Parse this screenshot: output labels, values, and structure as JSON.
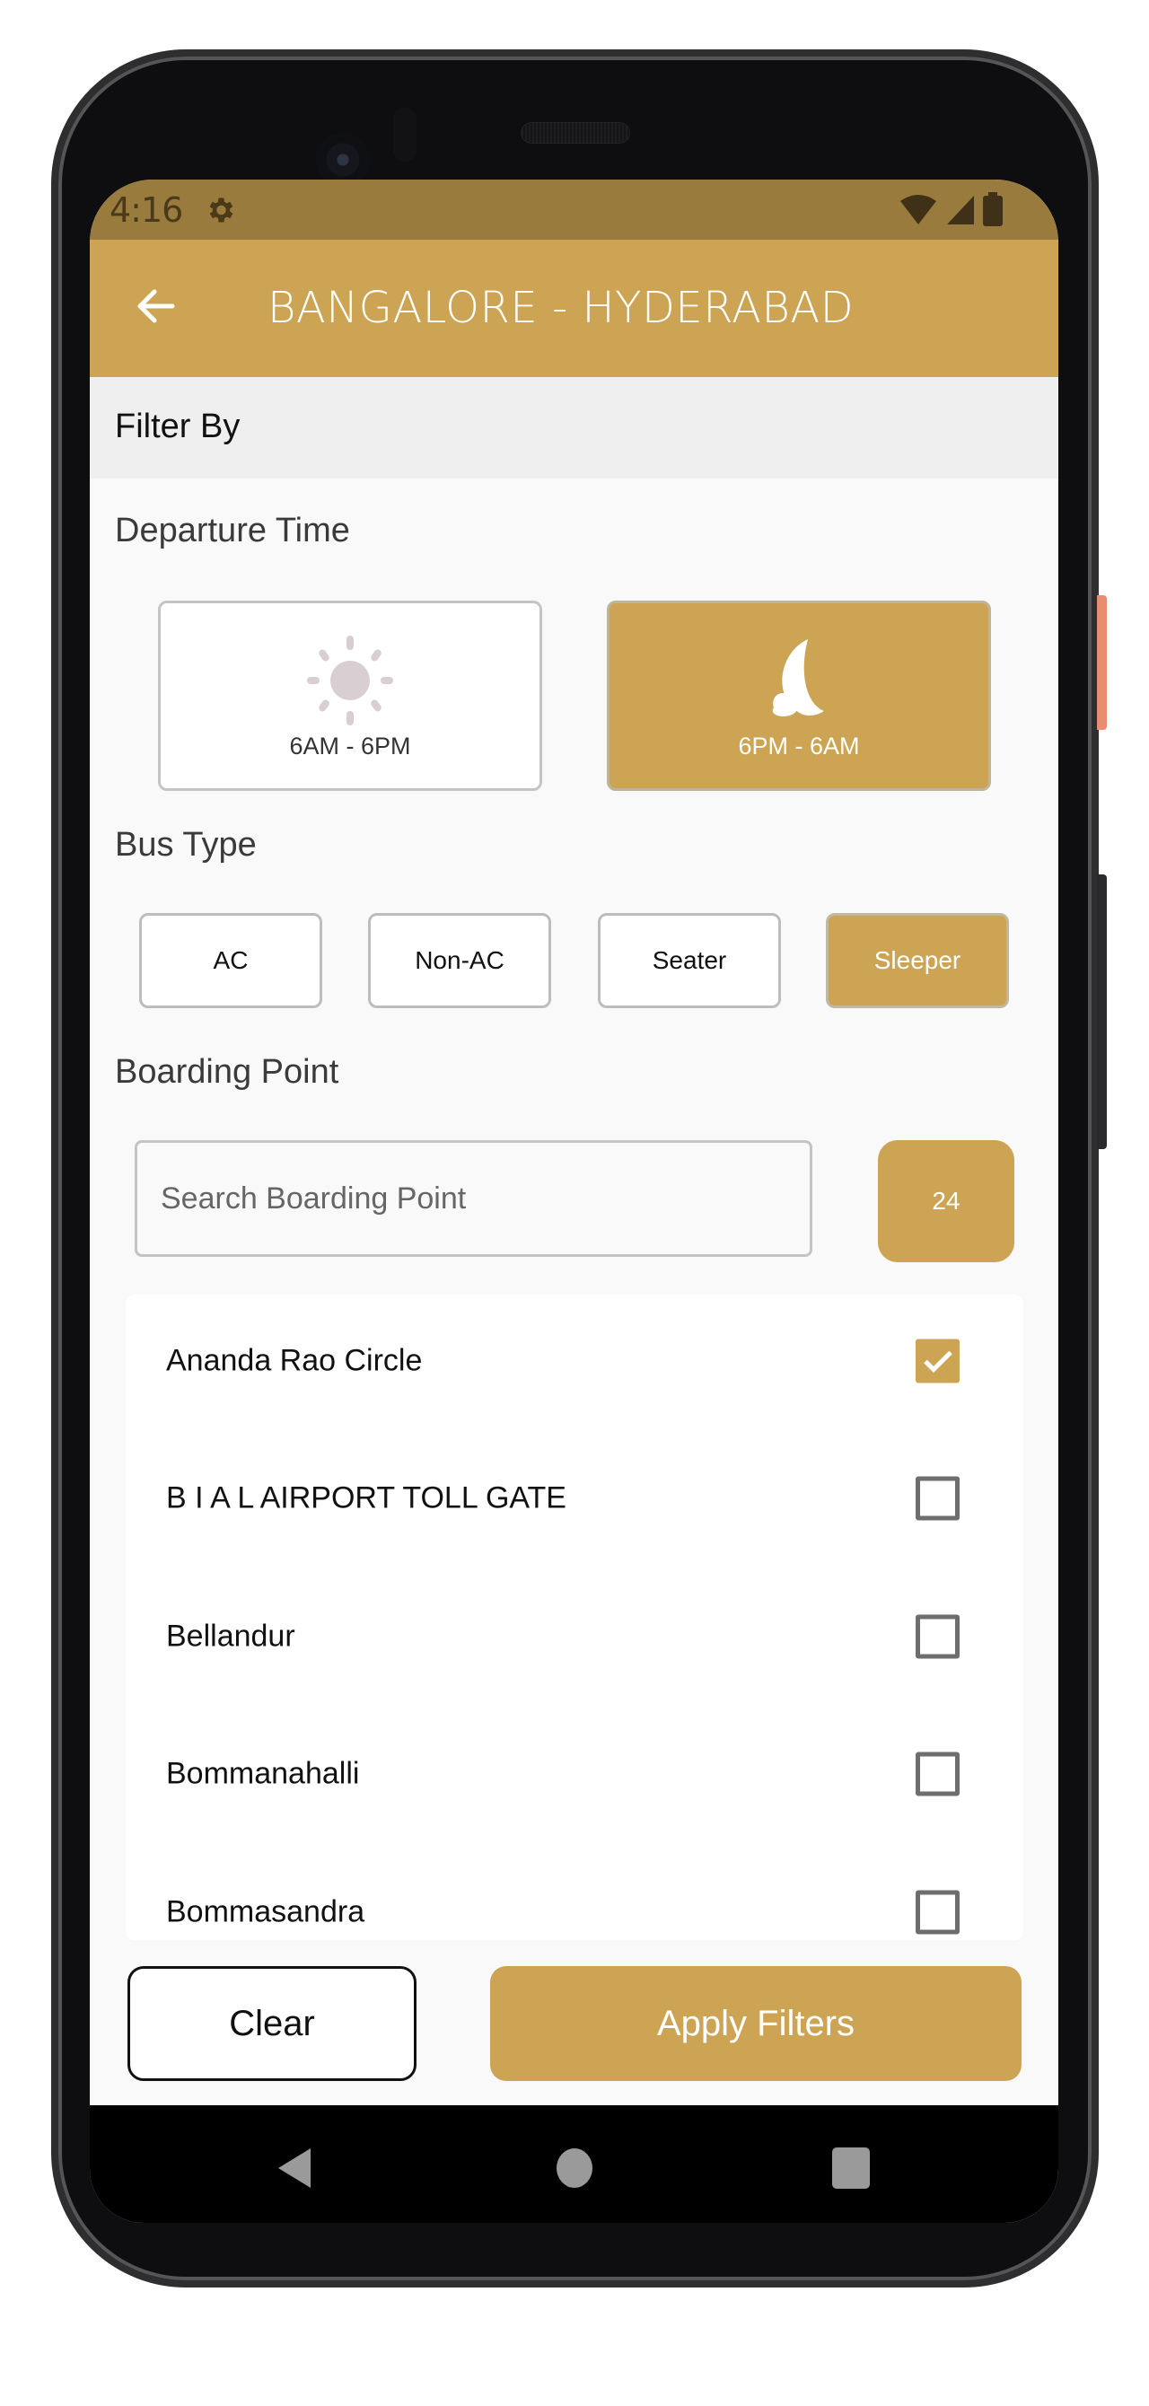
{
  "status_bar": {
    "time": "4:16",
    "icons": [
      "settings-gear-icon",
      "wifi-icon",
      "cellular-signal-icon",
      "battery-icon"
    ]
  },
  "header": {
    "back_icon": "arrow-left-icon",
    "title": "BANGALORE - HYDERABAD"
  },
  "filter_by": {
    "label": "Filter By"
  },
  "departure_time": {
    "label": "Departure Time",
    "options": [
      {
        "label": "6AM - 6PM",
        "icon": "sun-icon",
        "selected": false
      },
      {
        "label": "6PM - 6AM",
        "icon": "moon-cloud-icon",
        "selected": true
      }
    ]
  },
  "bus_type": {
    "label": "Bus Type",
    "options": [
      {
        "label": "AC",
        "selected": false
      },
      {
        "label": "Non-AC",
        "selected": false
      },
      {
        "label": "Seater",
        "selected": false
      },
      {
        "label": "Sleeper",
        "selected": true
      }
    ]
  },
  "boarding_point": {
    "label": "Boarding Point",
    "search_placeholder": "Search Boarding Point",
    "search_value": "",
    "count": "24",
    "items": [
      {
        "label": "Ananda Rao Circle",
        "checked": true
      },
      {
        "label": "B I A L AIRPORT TOLL GATE",
        "checked": false
      },
      {
        "label": "Bellandur",
        "checked": false
      },
      {
        "label": "Bommanahalli",
        "checked": false
      },
      {
        "label": "Bommasandra",
        "checked": false
      }
    ]
  },
  "actions": {
    "clear_label": "Clear",
    "apply_label": "Apply Filters"
  },
  "nav_bar": {
    "buttons": [
      "back-triangle-icon",
      "home-circle-icon",
      "recents-square-icon"
    ]
  },
  "colors": {
    "accent": "#cda453",
    "status_bar": "#9a7b3e",
    "filter_bar": "#efefef",
    "background": "#f9f9f9"
  }
}
